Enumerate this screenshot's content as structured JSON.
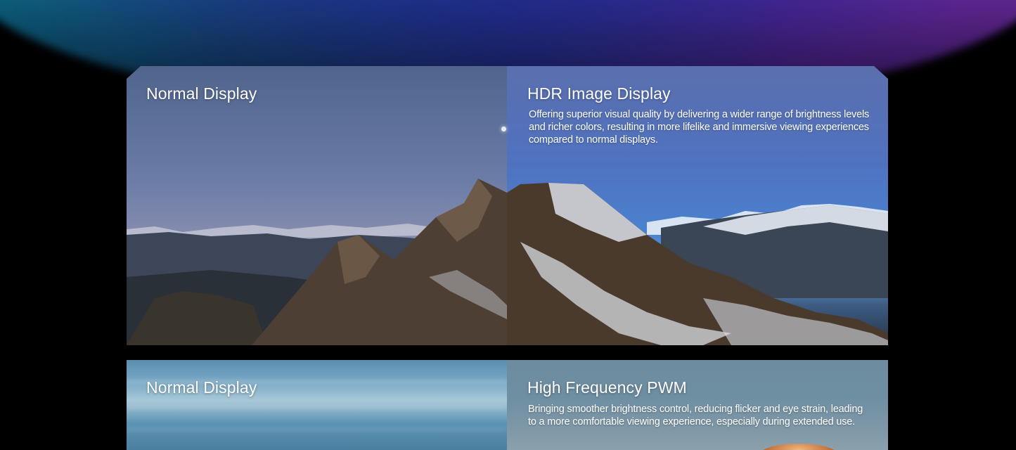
{
  "panels": [
    {
      "left": {
        "title": "Normal Display"
      },
      "right": {
        "title": "HDR Image Display",
        "description": "Offering superior visual quality by delivering a wider range of brightness levels and richer colors, resulting in more lifelike and immersive viewing experiences compared to normal displays."
      }
    },
    {
      "left": {
        "title": "Normal Display"
      },
      "right": {
        "title": "High Frequency PWM",
        "description": "Bringing smoother brightness control, reducing flicker and eye strain, leading to a more comfortable viewing experience, especially during extended use."
      }
    }
  ],
  "colors": {
    "background": "#000000",
    "glow_teal": "#0b6a86",
    "glow_blue": "#2a3aa8",
    "glow_purple": "#6a2a9a",
    "text": "#ffffff"
  }
}
